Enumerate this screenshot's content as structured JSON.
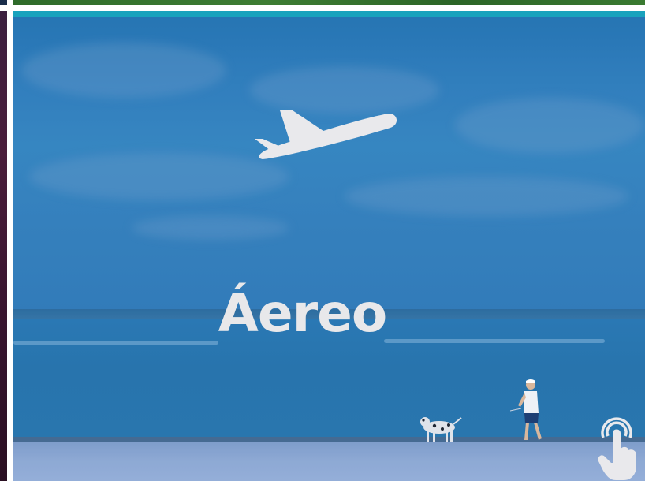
{
  "card": {
    "title": "Áereo",
    "icon": "airplane-icon",
    "hint_icon": "tap-hand-icon"
  },
  "colors": {
    "accent_bar": "#19a2bd",
    "title_text": "#e8e8ea",
    "top_strip": "#2f6b2a"
  }
}
